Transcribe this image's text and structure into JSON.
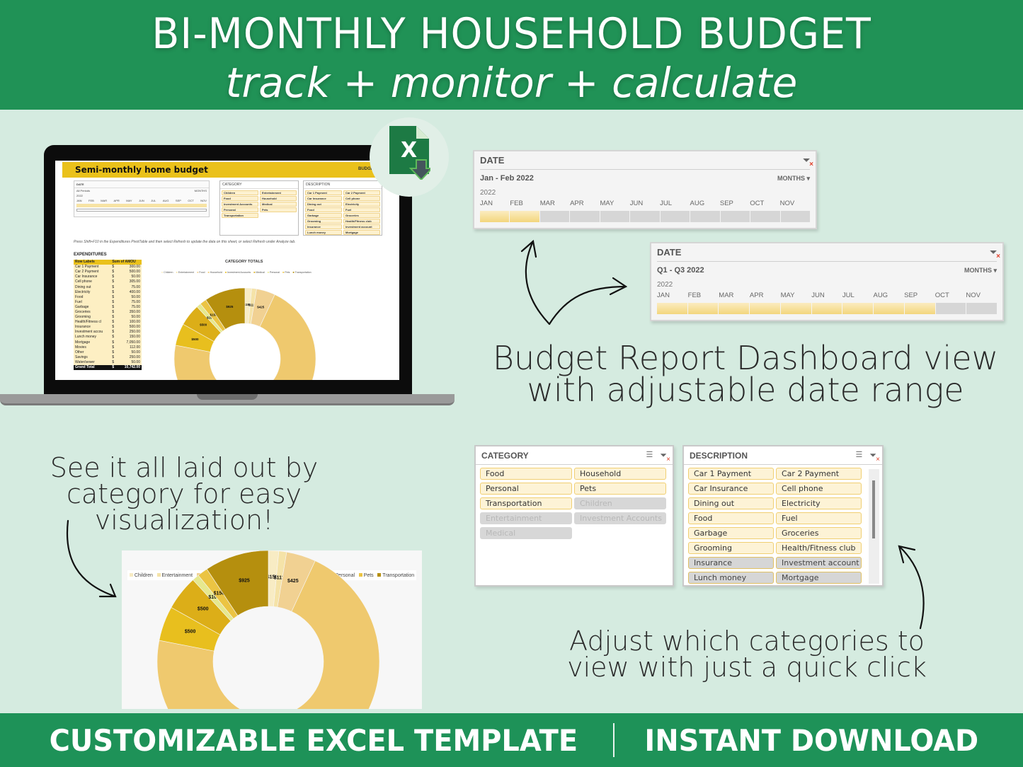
{
  "header": {
    "title": "BI-MONTHLY HOUSEHOLD BUDGET",
    "subtitle": "track + monitor + calculate"
  },
  "footer": {
    "left": "CUSTOMIZABLE EXCEL TEMPLATE",
    "right": "INSTANT DOWNLOAD"
  },
  "colors": {
    "brand_green": "#209256",
    "background": "#d5ebe0",
    "accent_yellow": "#eac11b"
  },
  "excel_icon": {
    "letter": "X",
    "icon": "excel-download-icon"
  },
  "laptop_screen": {
    "title": "Semi-monthly home budget",
    "report_label": "BUDGET REPORT",
    "date_slicer": {
      "title": "DATE",
      "range": "All Periods",
      "level": "MONTHS",
      "year": "2022",
      "months": [
        "JAN",
        "FEB",
        "MAR",
        "APR",
        "MAY",
        "JUN",
        "JUL",
        "AUG",
        "SEP",
        "OCT",
        "NOV"
      ]
    },
    "category_slicer": {
      "title": "CATEGORY",
      "items": [
        "Children",
        "Entertainment",
        "Food",
        "Household",
        "Investment Accounts",
        "Medical",
        "Personal",
        "Pets",
        "Transportation"
      ]
    },
    "description_slicer": {
      "title": "DESCRIPTION",
      "items": [
        "Car 1 Payment",
        "Car 2 Payment",
        "Car Insurance",
        "Cell phone",
        "Dining out",
        "Electricity",
        "Food",
        "Fuel",
        "Garbage",
        "Groceries",
        "Grooming",
        "Health/Fitness club",
        "Insurance",
        "Investment account",
        "Lunch money",
        "Mortgage"
      ]
    },
    "note": "Press Shift+F10 in the Expenditures PivotTable and then select Refresh to update the data on this sheet, or select Refresh under Analyze tab.",
    "expenditures": {
      "title": "EXPENDITURES",
      "headers": [
        "Row Labels",
        "Sum of AMOU"
      ],
      "rows": [
        [
          "Car 1 Payment",
          "$",
          "300.00"
        ],
        [
          "Car 2 Payment",
          "$",
          "500.00"
        ],
        [
          "Car Insurance",
          "$",
          "50.00"
        ],
        [
          "Cell phone",
          "$",
          "305.00"
        ],
        [
          "Dining out",
          "$",
          "75.00"
        ],
        [
          "Electricity",
          "$",
          "400.00"
        ],
        [
          "Food",
          "$",
          "50.00"
        ],
        [
          "Fuel",
          "$",
          "75.00"
        ],
        [
          "Garbage",
          "$",
          "75.00"
        ],
        [
          "Groceries",
          "$",
          "350.00"
        ],
        [
          "Grooming",
          "$",
          "50.00"
        ],
        [
          "Health/Fitness cl",
          "$",
          "100.00"
        ],
        [
          "Insurance",
          "$",
          "500.00"
        ],
        [
          "Investment accou",
          "$",
          "250.00"
        ],
        [
          "Lunch money",
          "$",
          "150.00"
        ],
        [
          "Mortgage",
          "$",
          "7,050.00"
        ],
        [
          "Movies",
          "$",
          "112.00"
        ],
        [
          "Other",
          "$",
          "50.00"
        ],
        [
          "Savings",
          "$",
          "250.00"
        ],
        [
          "Water/sewer",
          "$",
          "50.00"
        ]
      ],
      "total": [
        "Grand Total",
        "$",
        "10,742.00"
      ]
    }
  },
  "date_slicer_1": {
    "title": "DATE",
    "range": "Jan - Feb 2022",
    "level": "MONTHS",
    "year": "2022",
    "months": [
      "JAN",
      "FEB",
      "MAR",
      "APR",
      "MAY",
      "JUN",
      "JUL",
      "AUG",
      "SEP",
      "OCT",
      "NOV"
    ],
    "selected_count": 2
  },
  "date_slicer_2": {
    "title": "DATE",
    "range": "Q1 - Q3 2022",
    "level": "MONTHS",
    "year": "2022",
    "months": [
      "JAN",
      "FEB",
      "MAR",
      "APR",
      "MAY",
      "JUN",
      "JUL",
      "AUG",
      "SEP",
      "OCT",
      "NOV"
    ],
    "selected_count": 9
  },
  "category_slicer": {
    "title": "CATEGORY",
    "items": [
      {
        "label": "Food",
        "state": "sel"
      },
      {
        "label": "Household",
        "state": "sel"
      },
      {
        "label": "Personal",
        "state": "sel"
      },
      {
        "label": "Pets",
        "state": "sel"
      },
      {
        "label": "Transportation",
        "state": "sel"
      },
      {
        "label": "Children",
        "state": "dim"
      },
      {
        "label": "Entertainment",
        "state": "dim"
      },
      {
        "label": "Investment Accounts",
        "state": "dim"
      },
      {
        "label": "Medical",
        "state": "dim"
      }
    ]
  },
  "description_slicer": {
    "title": "DESCRIPTION",
    "items": [
      {
        "label": "Car 1 Payment",
        "state": "sel"
      },
      {
        "label": "Car 2 Payment",
        "state": "sel"
      },
      {
        "label": "Car Insurance",
        "state": "sel"
      },
      {
        "label": "Cell phone",
        "state": "sel"
      },
      {
        "label": "Dining out",
        "state": "sel"
      },
      {
        "label": "Electricity",
        "state": "sel"
      },
      {
        "label": "Food",
        "state": "sel"
      },
      {
        "label": "Fuel",
        "state": "sel"
      },
      {
        "label": "Garbage",
        "state": "sel"
      },
      {
        "label": "Groceries",
        "state": "sel"
      },
      {
        "label": "Grooming",
        "state": "sel"
      },
      {
        "label": "Health/Fitness club",
        "state": "sel"
      },
      {
        "label": "Insurance",
        "state": "grey"
      },
      {
        "label": "Investment account",
        "state": "grey"
      },
      {
        "label": "Lunch money",
        "state": "grey"
      },
      {
        "label": "Mortgage",
        "state": "grey"
      }
    ]
  },
  "captions": {
    "dashboard": [
      "Budget Report Dashboard view",
      "with adjustable date range"
    ],
    "category": [
      "See it all laid out by",
      "category for easy",
      "visualization!"
    ],
    "adjust": [
      "Adjust which categories to",
      "view with just a quick click"
    ]
  },
  "chart_data": {
    "type": "pie",
    "variant": "donut",
    "title": "CATEGORY TOTALS",
    "legend_position": "top",
    "categories": [
      "Children",
      "Entertainment",
      "Food",
      "Household",
      "Investment Accounts",
      "Medical",
      "Personal",
      "Pets",
      "Transportation"
    ],
    "values": [
      150,
      112,
      425,
      7050,
      500,
      500,
      100,
      150,
      925
    ],
    "labels": [
      "$150",
      "$112",
      "$425",
      "",
      "$500",
      "$500",
      "$100",
      "$150",
      "$925"
    ],
    "colors": [
      "#f8ecc4",
      "#f5e3a8",
      "#f1d192",
      "#efc96e",
      "#e8bf1e",
      "#dcae18",
      "#e6e88e",
      "#ebc443",
      "#b58f0e"
    ]
  }
}
